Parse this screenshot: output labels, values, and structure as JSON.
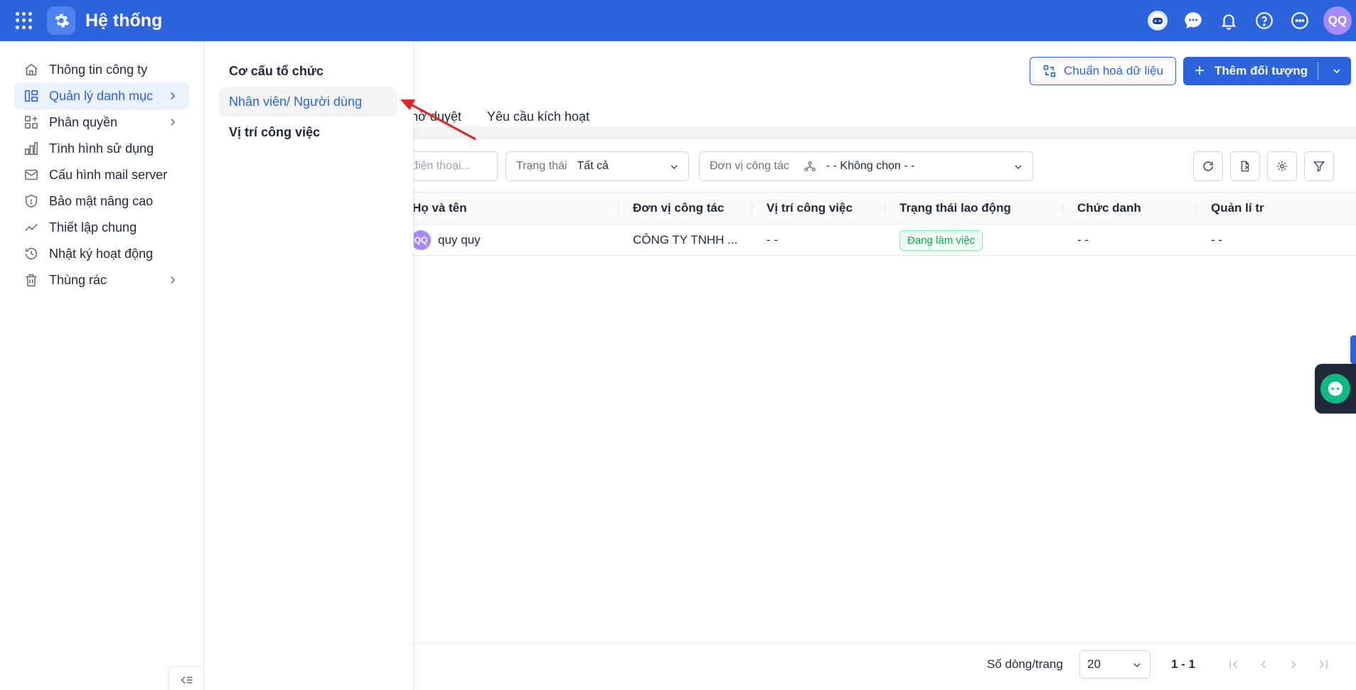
{
  "header": {
    "title": "Hệ thống",
    "avatar_initials": "QQ",
    "icons": [
      "apps-grid-icon",
      "settings-icon",
      "assistant-bot-icon",
      "chat-icon",
      "bell-icon",
      "help-icon",
      "more-icon"
    ]
  },
  "sidebar": {
    "items": [
      {
        "label": "Thông tin công ty",
        "icon": "home-icon",
        "has_children": false
      },
      {
        "label": "Quản lý danh mục",
        "icon": "category-icon",
        "has_children": true,
        "active": true
      },
      {
        "label": "Phân quyền",
        "icon": "permission-icon",
        "has_children": true
      },
      {
        "label": "Tình hình sử dụng",
        "icon": "bar-chart-icon",
        "has_children": false
      },
      {
        "label": "Cấu hình mail server",
        "icon": "mail-icon",
        "has_children": false
      },
      {
        "label": "Bảo mật nâng cao",
        "icon": "shield-icon",
        "has_children": false
      },
      {
        "label": "Thiết lập chung",
        "icon": "trend-icon",
        "has_children": false
      },
      {
        "label": "Nhật ký hoạt động",
        "icon": "history-icon",
        "has_children": false
      },
      {
        "label": "Thùng rác",
        "icon": "trash-icon",
        "has_children": true
      }
    ]
  },
  "submenu": {
    "items": [
      {
        "label": "Cơ cấu tổ chức"
      },
      {
        "label": "Nhân viên/ Người dùng",
        "active": true
      },
      {
        "label": "Vị trí công việc"
      }
    ]
  },
  "toolbar": {
    "normalize_label": "Chuẩn hoá dữ liệu",
    "add_label": "Thêm đối tượng"
  },
  "tabs": [
    "hờ duyệt",
    "Yêu cầu kích hoạt"
  ],
  "filters": {
    "search_placeholder": "điện thoại...",
    "status_label": "Trạng thái",
    "status_value": "Tất cả",
    "unit_label": "Đơn vị công tác",
    "unit_value": "- - Không chọn - -"
  },
  "table": {
    "columns": [
      "Họ và tên",
      "Đơn vị công tác",
      "Vị trí công việc",
      "Trạng thái lao động",
      "Chức danh",
      "Quản lí tr"
    ],
    "rows": [
      {
        "avatar": "QQ",
        "name": "quy quy",
        "unit": "CÔNG TY TNHH ...",
        "position": "- -",
        "status": "Đang làm việc",
        "title": "- -",
        "manager": "- -"
      }
    ]
  },
  "pagination": {
    "rows_per_page_label": "Số dòng/trang",
    "rows_per_page": "20",
    "range": "1 - 1"
  },
  "colors": {
    "brand": "#2c64e0",
    "success": "#16a34a"
  }
}
